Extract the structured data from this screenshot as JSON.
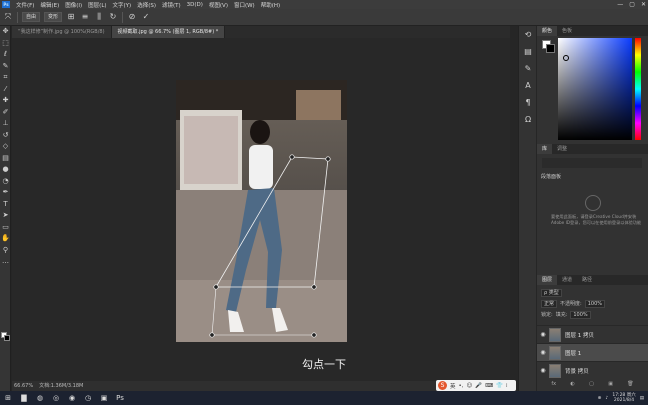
{
  "app": {
    "logo": "Ps"
  },
  "menubar": {
    "items": [
      "文件(F)",
      "编辑(E)",
      "图像(I)",
      "图层(L)",
      "文字(Y)",
      "选择(S)",
      "滤镜(T)",
      "3D(D)",
      "视图(V)",
      "窗口(W)",
      "帮助(H)"
    ],
    "window_controls": [
      "—",
      "▢",
      "✕"
    ]
  },
  "optionsbar": {
    "buttons": [
      "自由",
      "变形"
    ]
  },
  "tabs": [
    {
      "label": "“我这样修”制作.jpg @ 100%(RGB/8)",
      "active": false
    },
    {
      "label": "视频截取.jpg @ 66.7% (图层 1, RGB/8#) *",
      "active": true
    }
  ],
  "canvas": {
    "caption": "勾点一下"
  },
  "statusbar": {
    "zoom": "66.67%",
    "doc": "文档:1.36M/3.18M"
  },
  "panels": {
    "color_tabs": [
      "颜色",
      "色板"
    ],
    "adjust_tabs": [
      "库",
      "调整"
    ],
    "adjust_title": "段落面板",
    "adjust_desc": "要使用此面板，请登录Creative Cloud并安装Adobe ID登录，您可以在使用前登录以体验功能",
    "layer_tabs": [
      "图层",
      "通道",
      "路径"
    ],
    "filter_label": "ρ 类型",
    "blend_mode": "正常",
    "opacity_label": "不透明度:",
    "opacity_value": "100%",
    "lock_label": "锁定:",
    "fill_label": "填充:",
    "fill_value": "100%",
    "layers": [
      {
        "name": "图层 1 拷贝",
        "selected": false,
        "locked": false
      },
      {
        "name": "图层 1",
        "selected": true,
        "locked": false
      },
      {
        "name": "背景 拷贝",
        "selected": false,
        "locked": false
      }
    ],
    "bottom_icons": [
      "fx",
      "◐",
      "▢",
      "▣",
      "🗑"
    ]
  },
  "ime": {
    "label": "英"
  },
  "taskbar": {
    "time": "17:28 周六",
    "date": "2021/8/4"
  },
  "colors": {
    "accent": "#1f6fd1",
    "canvas_bg": "#282828",
    "panel_bg": "#323232"
  },
  "icons": {
    "tools": [
      "move-icon",
      "marquee-icon",
      "lasso-icon",
      "quick-select-icon",
      "crop-icon",
      "eyedropper-icon",
      "healing-icon",
      "brush-icon",
      "stamp-icon",
      "history-brush-icon",
      "eraser-icon",
      "gradient-icon",
      "blur-icon",
      "dodge-icon",
      "pen-icon",
      "type-icon",
      "path-select-icon",
      "shape-icon",
      "hand-icon",
      "zoom-icon"
    ]
  }
}
